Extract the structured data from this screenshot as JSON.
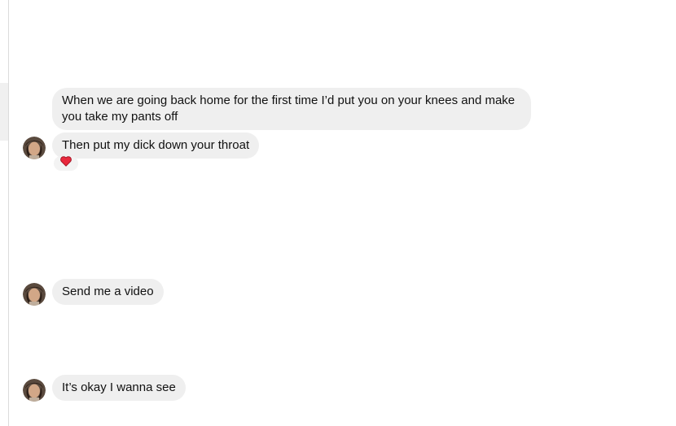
{
  "conversation": {
    "messages": [
      {
        "text": "When we are going back home for the first time I’d put you on your knees and make you take my pants off"
      },
      {
        "text": "Then put my dick down your throat",
        "reaction": "heart"
      },
      {
        "text": "Send me a video"
      },
      {
        "text": "It’s okay I wanna see"
      }
    ]
  },
  "colors": {
    "bubble": "#efefef",
    "reaction_heart": "#e8283c"
  }
}
